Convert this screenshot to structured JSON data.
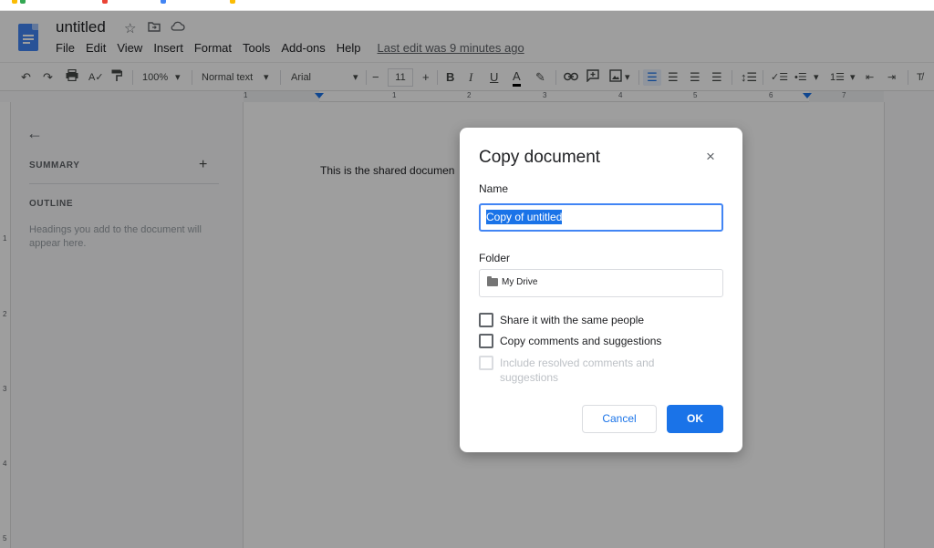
{
  "document": {
    "title": "untitled",
    "body_text": "This is the shared documen"
  },
  "menubar": {
    "items": [
      "File",
      "Edit",
      "View",
      "Insert",
      "Format",
      "Tools",
      "Add-ons",
      "Help"
    ],
    "last_edit": "Last edit was 9 minutes ago"
  },
  "toolbar": {
    "zoom": "100%",
    "style": "Normal text",
    "font": "Arial",
    "font_size": "11",
    "bold": "B",
    "italic": "I",
    "underline": "U",
    "text_color": "A",
    "icons": [
      "undo-icon",
      "redo-icon",
      "print-icon",
      "spellcheck-icon",
      "paint-format-icon",
      "link-icon",
      "comment-icon",
      "image-icon",
      "align-left-icon",
      "align-center-icon",
      "align-right-icon",
      "justify-icon",
      "line-spacing-icon",
      "checklist-icon",
      "bulleted-list-icon",
      "numbered-list-icon",
      "decrease-indent-icon",
      "increase-indent-icon",
      "clear-formatting-icon"
    ]
  },
  "ruler": {
    "numbers": [
      "1",
      "1",
      "2",
      "3",
      "4",
      "5",
      "6",
      "7"
    ],
    "vertical_numbers": [
      "1",
      "2",
      "3",
      "4",
      "5"
    ]
  },
  "sidebar": {
    "summary": "SUMMARY",
    "outline": "OUTLINE",
    "hint": "Headings you add to the document will appear here."
  },
  "dialog": {
    "title": "Copy document",
    "close": "×",
    "name_label": "Name",
    "name_value": "Copy of untitled",
    "folder_label": "Folder",
    "folder_value": "My Drive",
    "options": [
      {
        "label": "Share it with the same people",
        "checked": false,
        "disabled": false
      },
      {
        "label": "Copy comments and suggestions",
        "checked": false,
        "disabled": false
      },
      {
        "label": "Include resolved comments and suggestions",
        "checked": false,
        "disabled": true
      }
    ],
    "cancel": "Cancel",
    "ok": "OK"
  },
  "colors": {
    "accent": "#1a73e8",
    "docs_blue": "#4285f4",
    "overlay": "rgba(0,0,0,0.38)"
  }
}
